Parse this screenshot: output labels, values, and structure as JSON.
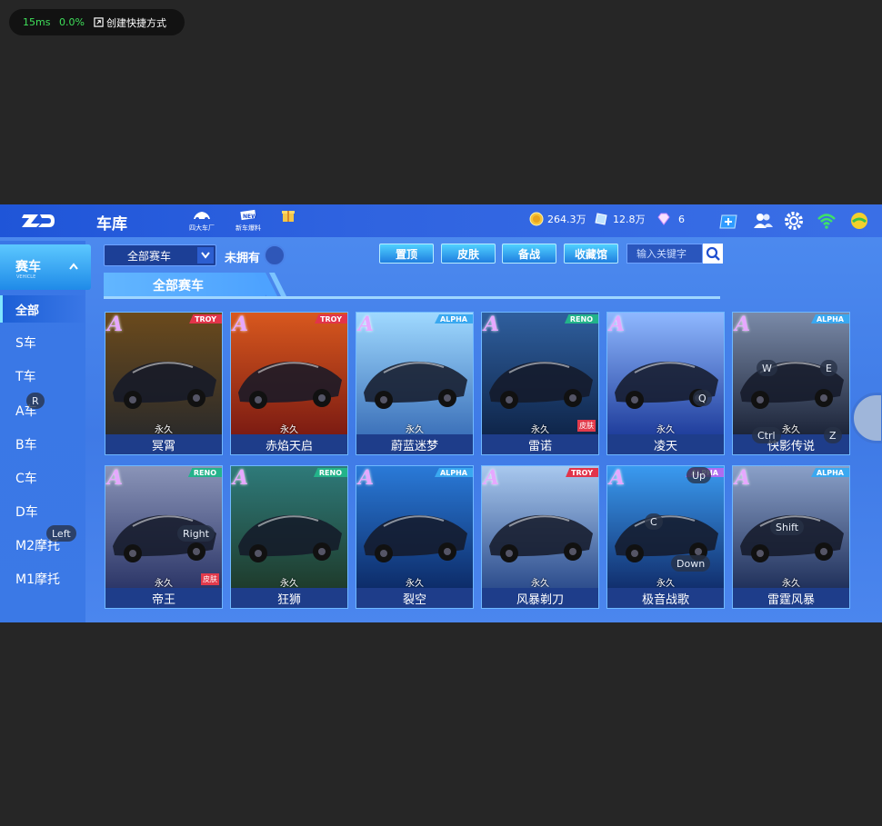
{
  "overlay": {
    "latency": "15ms",
    "loss": "0.0%",
    "shortcut": "创建快捷方式"
  },
  "header": {
    "title": "车库",
    "icons": [
      {
        "label": "四大车厂",
        "icon": "car-factory-icon"
      },
      {
        "label": "新车爆料",
        "icon": "new-car-icon"
      },
      {
        "label": "",
        "icon": "gift-icon"
      }
    ],
    "coins": "264.3万",
    "tickets": "12.8万",
    "diamonds": "6"
  },
  "sidebar": {
    "category": {
      "label": "赛车",
      "sub": "VEHICLE"
    },
    "items": [
      "全部",
      "S车",
      "T车",
      "A车",
      "B车",
      "C车",
      "D车",
      "M2摩托",
      "M1摩托"
    ]
  },
  "toolbar": {
    "filter": "全部赛车",
    "owned_label": "未拥有",
    "buttons": [
      "置顶",
      "皮肤",
      "备战",
      "收藏馆"
    ],
    "search_placeholder": "输入关键字"
  },
  "section_title": "全部赛车",
  "cars": [
    {
      "name": "冥霄",
      "grade": "A",
      "tag": "TROY",
      "tag_color": "#e2344a",
      "perm": "永久",
      "skin": "",
      "c1": "#6b4a1c",
      "c2": "#2a2a2a"
    },
    {
      "name": "赤焰天启",
      "grade": "A",
      "tag": "TROY",
      "tag_color": "#e2344a",
      "perm": "永久",
      "skin": "",
      "c1": "#d8581e",
      "c2": "#7a1a12"
    },
    {
      "name": "蔚蓝迷梦",
      "grade": "A",
      "tag": "ALPHA",
      "tag_color": "#3aa8f0",
      "perm": "永久",
      "skin": "",
      "c1": "#9fd9ff",
      "c2": "#3a6fb8"
    },
    {
      "name": "雷诺",
      "grade": "A",
      "tag": "RENO",
      "tag_color": "#23b38a",
      "perm": "永久",
      "skin": "皮肤",
      "c1": "#2f5f9e",
      "c2": "#0e2448"
    },
    {
      "name": "凌天",
      "grade": "A",
      "tag": "",
      "tag_color": "#3aa8f0",
      "perm": "永久",
      "skin": "",
      "c1": "#8fb8ff",
      "c2": "#1d3b9a"
    },
    {
      "name": "快影传说",
      "grade": "A",
      "tag": "ALPHA",
      "tag_color": "#3aa8f0",
      "perm": "永久",
      "skin": "",
      "c1": "#7a8aa8",
      "c2": "#1a2236"
    },
    {
      "name": "帝王",
      "grade": "A",
      "tag": "RENO",
      "tag_color": "#23b38a",
      "perm": "永久",
      "skin": "皮肤",
      "c1": "#8a94b8",
      "c2": "#2a3466"
    },
    {
      "name": "狂狮",
      "grade": "A",
      "tag": "RENO",
      "tag_color": "#23b38a",
      "perm": "永久",
      "skin": "",
      "c1": "#2e7a7a",
      "c2": "#1e3a2a"
    },
    {
      "name": "裂空",
      "grade": "A",
      "tag": "ALPHA",
      "tag_color": "#3aa8f0",
      "perm": "永久",
      "skin": "",
      "c1": "#2a7ad8",
      "c2": "#0c2a66"
    },
    {
      "name": "风暴剃刀",
      "grade": "A",
      "tag": "TROY",
      "tag_color": "#e2344a",
      "perm": "永久",
      "skin": "",
      "c1": "#a8c8ee",
      "c2": "#2a4a8a"
    },
    {
      "name": "极音战歌",
      "grade": "A",
      "tag": "ALPHA",
      "tag_color": "#b06cf0",
      "perm": "永久",
      "skin": "",
      "c1": "#3a9af0",
      "c2": "#102c6a"
    },
    {
      "name": "雷霆风暴",
      "grade": "A",
      "tag": "ALPHA",
      "tag_color": "#3aa8f0",
      "perm": "永久",
      "skin": "",
      "c1": "#8aa0c8",
      "c2": "#1e2e58"
    }
  ],
  "key_hints": [
    "R",
    "Left",
    "Right",
    "W",
    "E",
    "Q",
    "Ctrl",
    "Z",
    "Up",
    "C",
    "Shift",
    "Down"
  ]
}
